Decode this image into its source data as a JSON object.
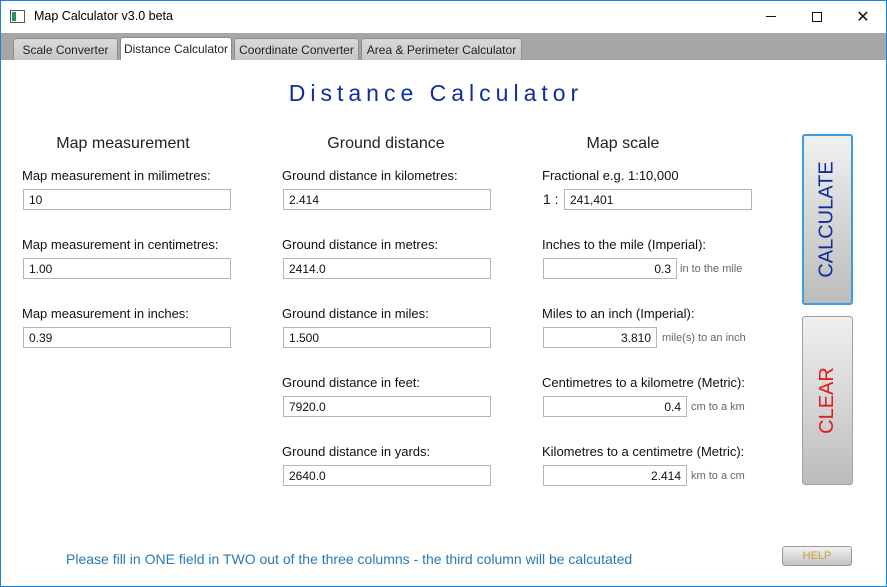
{
  "window": {
    "title": "Map Calculator v3.0 beta",
    "minimize_icon": "minimize-icon",
    "maximize_icon": "maximize-icon",
    "close_icon": "close-icon",
    "close_glyph": "✕"
  },
  "tabs": [
    {
      "label": "Scale Converter",
      "active": false
    },
    {
      "label": "Distance Calculator",
      "active": true
    },
    {
      "label": "Coordinate Converter",
      "active": false
    },
    {
      "label": "Area & Perimeter  Calculator",
      "active": false
    }
  ],
  "main": {
    "title": "Distance Calculator"
  },
  "map_measurement": {
    "heading": "Map measurement",
    "mm_label": "Map measurement in milimetres:",
    "mm_value": "10",
    "cm_label": "Map measurement in centimetres:",
    "cm_value": "1.00",
    "in_label": "Map measurement in inches:",
    "in_value": "0.39"
  },
  "ground_distance": {
    "heading": "Ground distance",
    "km_label": "Ground distance in kilometres:",
    "km_value": "2.414",
    "m_label": "Ground distance in metres:",
    "m_value": "2414.0",
    "mi_label": "Ground distance in miles:",
    "mi_value": "1.500",
    "ft_label": "Ground distance in feet:",
    "ft_value": "7920.0",
    "yd_label": "Ground distance in yards:",
    "yd_value": "2640.0"
  },
  "map_scale": {
    "heading": "Map scale",
    "fractional_label": "Fractional e.g. 1:10,000",
    "fractional_prefix": "1  :",
    "fractional_value": "241,401",
    "inches_mile_label": "Inches to the mile (Imperial):",
    "inches_mile_value": "0.3",
    "inches_mile_unit": "in to the mile",
    "miles_inch_label": "Miles to an inch (Imperial):",
    "miles_inch_value": "3.810",
    "miles_inch_unit": "mile(s) to an inch",
    "cm_km_label": "Centimetres to a kilometre (Metric):",
    "cm_km_value": "0.4",
    "cm_km_unit": "cm to a km",
    "km_cm_label": "Kilometres to a centimetre (Metric):",
    "km_cm_value": "2.414",
    "km_cm_unit": "km to a cm"
  },
  "buttons": {
    "calculate": "CALCULATE",
    "clear": "CLEAR",
    "help": "HELP"
  },
  "footer": {
    "note": "Please fill in ONE field in TWO out of the three columns - the third column will be calcutated"
  },
  "colors": {
    "title_blue": "#0b2ea0",
    "clear_red": "#e21b1b",
    "note_blue": "#2a79b6",
    "help_gold": "#c7a233",
    "tabbar_gray": "#a6a6a6"
  }
}
